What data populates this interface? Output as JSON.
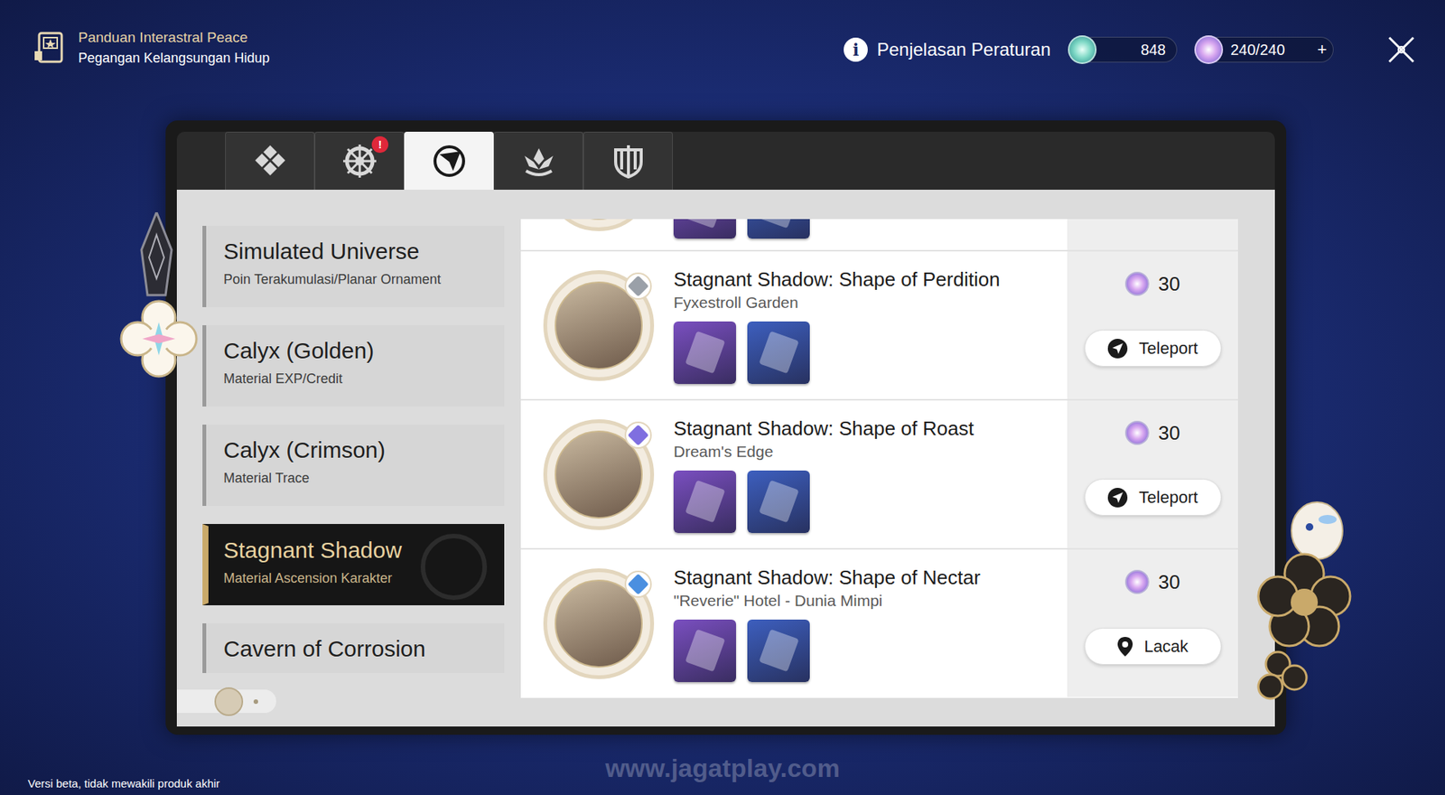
{
  "header": {
    "title": "Panduan Interastral Peace",
    "subtitle": "Pegangan Kelangsungan Hidup"
  },
  "rules": {
    "icon": "i",
    "label": "Penjelasan Peraturan"
  },
  "stellar_jade": {
    "value": "848"
  },
  "trailblaze_power": {
    "value": "240/240",
    "add_button": "+"
  },
  "tabs": [
    {
      "selected": false,
      "alert": false
    },
    {
      "selected": false,
      "alert": true,
      "badge": "!"
    },
    {
      "selected": true,
      "alert": false
    },
    {
      "selected": false,
      "alert": false
    },
    {
      "selected": false,
      "alert": false
    }
  ],
  "categories": [
    {
      "title": "Simulated Universe",
      "subtitle": "Poin Terakumulasi/Planar Ornament",
      "selected": false
    },
    {
      "title": "Calyx (Golden)",
      "subtitle": "Material EXP/Credit",
      "selected": false
    },
    {
      "title": "Calyx (Crimson)",
      "subtitle": "Material Trace",
      "selected": false
    },
    {
      "title": "Stagnant Shadow",
      "subtitle": "Material Ascension Karakter",
      "selected": true
    },
    {
      "title": "Cavern of Corrosion",
      "selected": false
    }
  ],
  "list": {
    "clipped_row": {
      "materials": [
        {
          "color": "#7a4fc0"
        },
        {
          "color": "#3d5fbf"
        }
      ]
    },
    "rows": [
      {
        "title": "Stagnant Shadow: Shape of Perdition",
        "location": "Fyxestroll Garden",
        "cost": "30",
        "element_color": "#9aa0a8",
        "action": {
          "kind": "teleport",
          "label": "Teleport"
        },
        "materials": [
          {
            "color": "#7a4fc0"
          },
          {
            "color": "#3d5fbf"
          }
        ]
      },
      {
        "title": "Stagnant Shadow: Shape of Roast",
        "location": "Dream's Edge",
        "cost": "30",
        "element_color": "#7f6fe0",
        "action": {
          "kind": "teleport",
          "label": "Teleport"
        },
        "materials": [
          {
            "color": "#7a4fc0"
          },
          {
            "color": "#3d5fbf"
          }
        ]
      },
      {
        "title": "Stagnant Shadow: Shape of Nectar",
        "location": "\"Reverie\" Hotel - Dunia Mimpi",
        "cost": "30",
        "element_color": "#4a8fe0",
        "action": {
          "kind": "track",
          "label": "Lacak"
        },
        "materials": [
          {
            "color": "#7a4fc0"
          },
          {
            "color": "#3d5fbf"
          }
        ]
      }
    ]
  },
  "footer": {
    "beta_notice": "Versi beta, tidak mewakili produk akhir",
    "watermark": "www.jagatplay.com"
  }
}
